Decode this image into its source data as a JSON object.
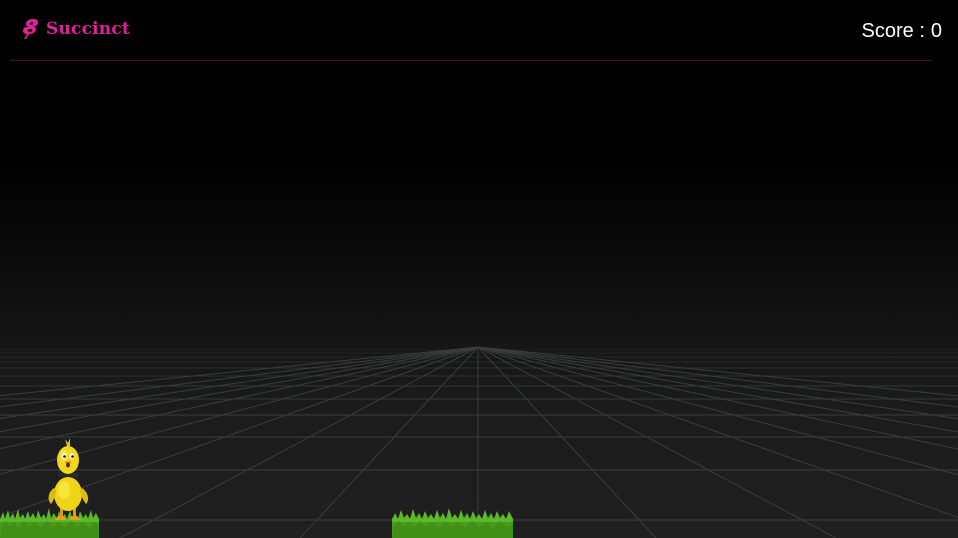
{
  "header": {
    "brand_name": "Succinct",
    "score_label": "Score :",
    "score_value": "0"
  },
  "colors": {
    "brand": "#e0219a",
    "score_text": "#ffffff",
    "grid": "#3c3f3f",
    "grass": "#4fa31f"
  },
  "icons": {
    "logo": "succinct-logo-icon"
  },
  "game": {
    "player": "yellow-chick",
    "platforms": 2
  }
}
